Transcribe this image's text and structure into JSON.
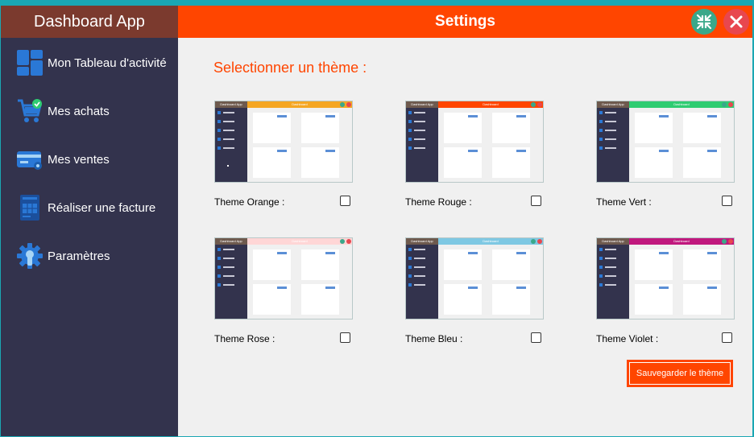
{
  "app_title": "Dashboard App",
  "header": {
    "title": "Settings"
  },
  "sidebar": {
    "items": [
      {
        "label": "Mon Tableau d'activité",
        "icon": "dashboard-tiles-icon"
      },
      {
        "label": "Mes achats",
        "icon": "shopping-cart-icon"
      },
      {
        "label": "Mes ventes",
        "icon": "credit-card-icon"
      },
      {
        "label": "Réaliser une facture",
        "icon": "invoice-icon"
      },
      {
        "label": "Paramètres",
        "icon": "gear-wrench-icon"
      }
    ]
  },
  "main": {
    "section_title": "Selectionner un thème :",
    "save_label": "Sauvegarder le thème",
    "themes": [
      {
        "label": "Theme Orange :",
        "color": "#f5a623",
        "checked": false
      },
      {
        "label": "Theme Rouge :",
        "color": "#ff4500",
        "checked": false
      },
      {
        "label": "Theme Vert :",
        "color": "#2ecc71",
        "checked": false
      },
      {
        "label": "Theme Rose :",
        "color": "#ffd6d6",
        "checked": false
      },
      {
        "label": "Theme Bleu :",
        "color": "#7ec8e3",
        "checked": false
      },
      {
        "label": "Theme Violet :",
        "color": "#c0187d",
        "checked": false
      }
    ],
    "thumbnail": {
      "app_title": "Dashboard App",
      "header_title": "Dashboard"
    }
  },
  "colors": {
    "accent": "#ff4500",
    "sidebar_bg": "#33334d",
    "app_title_bg": "#7b3a2e",
    "frame": "#1aa7b3"
  }
}
